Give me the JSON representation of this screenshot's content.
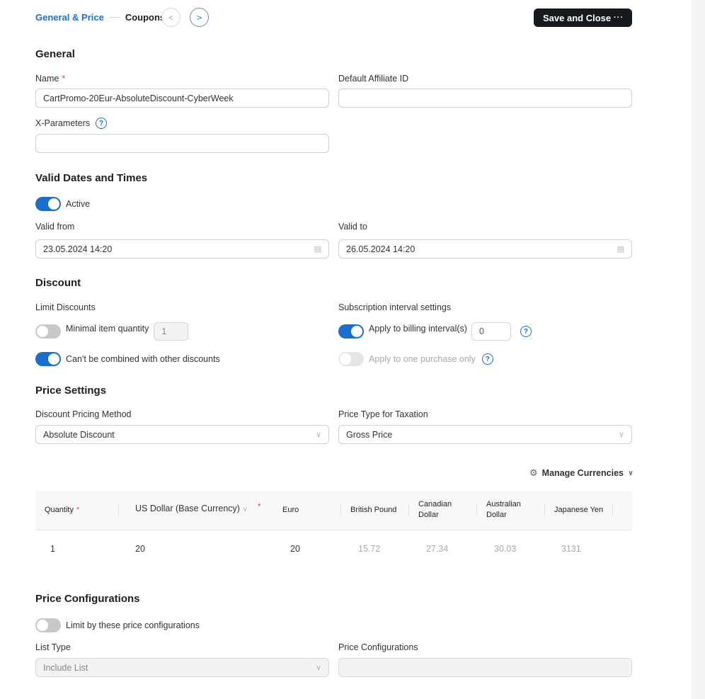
{
  "header": {
    "breadcrumb_active": "General & Price",
    "breadcrumb_next": "Coupons",
    "prev_icon": "chevron-left-icon",
    "next_icon": "chevron-right-icon",
    "save_label": "Save and Close",
    "more_label": "···"
  },
  "general": {
    "title": "General",
    "name_label": "Name",
    "name_required": "*",
    "name_value": "CartPromo-20Eur-AbsoluteDiscount-CyberWeek",
    "affiliate_label": "Default Affiliate ID",
    "affiliate_value": "",
    "xparams_label": "X-Parameters",
    "xparams_value": "",
    "help_glyph": "?"
  },
  "valid": {
    "title": "Valid Dates and Times",
    "active_label": "Active",
    "active_on": true,
    "from_label": "Valid from",
    "from_value": "23.05.2024 14:20",
    "to_label": "Valid to",
    "to_value": "26.05.2024 14:20",
    "calendar_glyph": "🗓"
  },
  "discount": {
    "title": "Discount",
    "limit_label": "Limit Discounts",
    "min_qty_label": "Minimal item quantity",
    "min_qty_on": false,
    "min_qty_value": "1",
    "no_combine_label": "Can't be combined with other discounts",
    "no_combine_on": true,
    "subscription_label": "Subscription interval settings",
    "billing_label": "Apply to billing interval(s)",
    "billing_on": true,
    "billing_value": "0",
    "one_purchase_label": "Apply to one purchase only",
    "one_purchase_on": false
  },
  "price_settings": {
    "title": "Price Settings",
    "method_label": "Discount Pricing Method",
    "method_value": "Absolute Discount",
    "tax_label": "Price Type for Taxation",
    "tax_value": "Gross Price",
    "manage_currencies": "Manage Currencies",
    "chevron": "∨",
    "gear_glyph": "⚙"
  },
  "price_table": {
    "columns": [
      "Quantity",
      "US Dollar (Base Currency)",
      "Euro",
      "British Pound",
      "Canadian Dollar",
      "Australian Dollar",
      "Japanese Yen"
    ],
    "column_lines": {
      "canadian": [
        "Canadian",
        "Dollar"
      ],
      "australian": [
        "Australian",
        "Dollar"
      ]
    },
    "required": "*",
    "rows": [
      [
        "1",
        "20",
        "20",
        "15.72",
        "27.34",
        "30.03",
        "3131"
      ]
    ]
  },
  "price_config": {
    "title": "Price Configurations",
    "limit_label": "Limit by these price configurations",
    "limit_on": false,
    "list_type_label": "List Type",
    "list_type_value": "Include List",
    "configs_label": "Price Configurations",
    "configs_value": ""
  }
}
